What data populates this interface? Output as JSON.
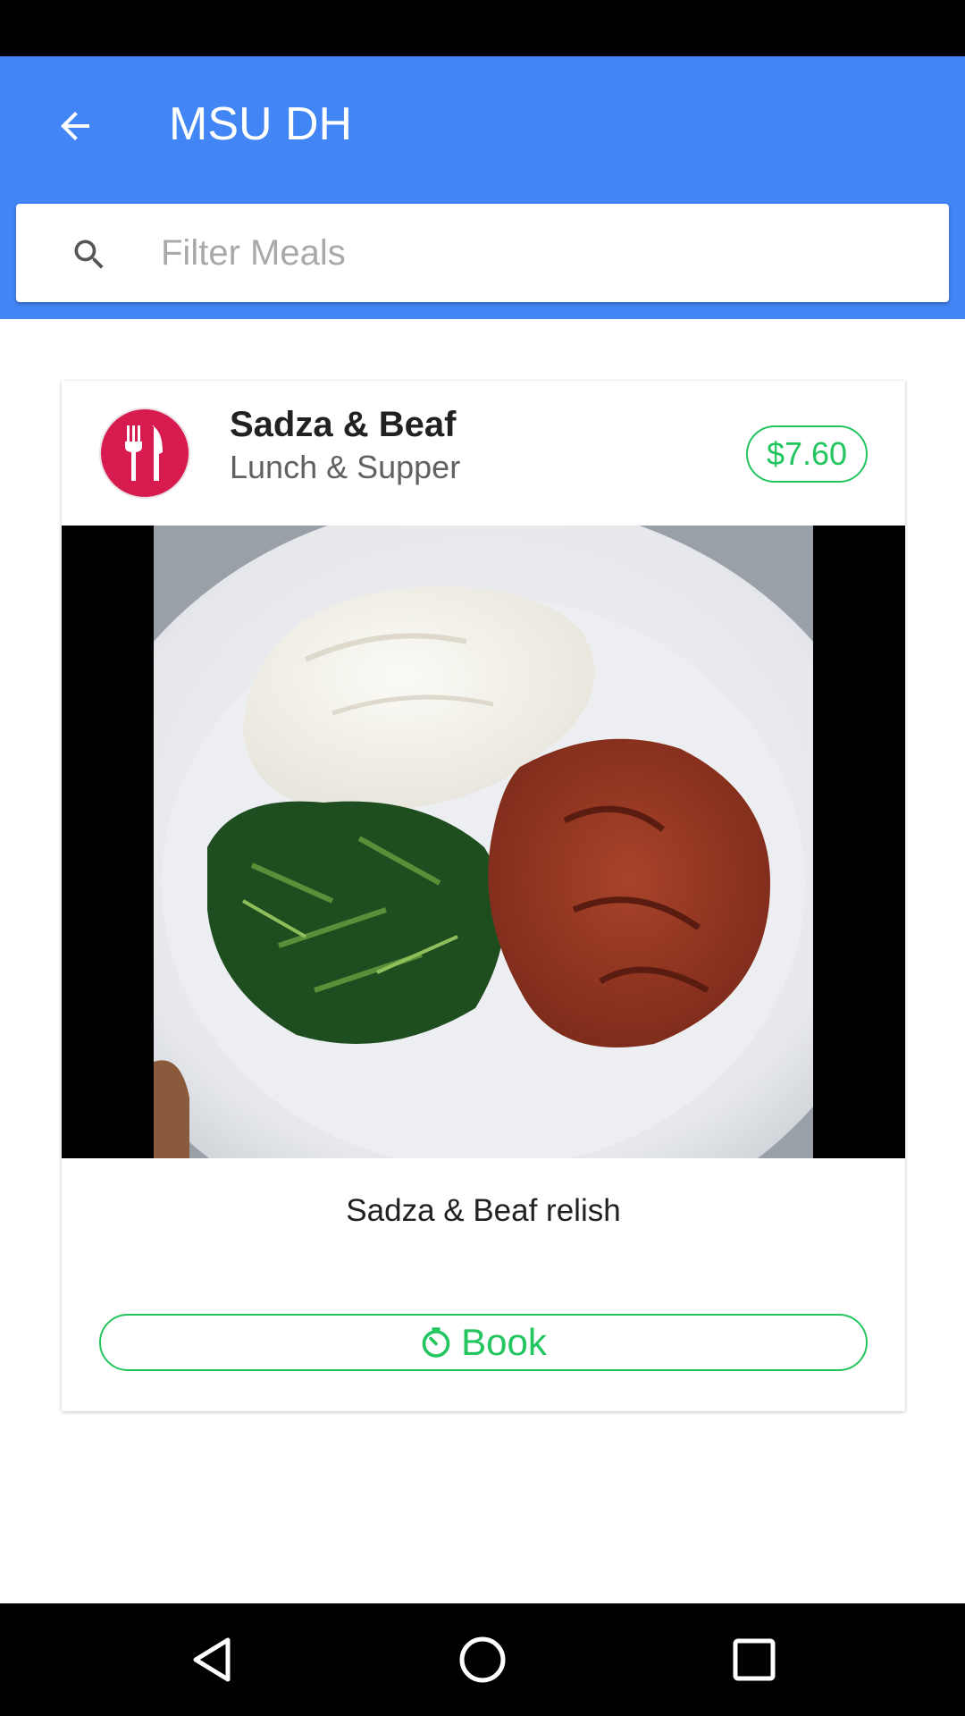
{
  "app_bar": {
    "title": "MSU DH",
    "color": "#4285f4",
    "back_icon": "arrow-back-icon"
  },
  "search": {
    "placeholder": "Filter Meals",
    "icon": "search-icon"
  },
  "meal_card": {
    "title": "Sadza & Beaf",
    "subtitle": "Lunch & Supper",
    "price": "$7.60",
    "avatar_icon": "fork-knife-icon",
    "avatar_color": "#d81b4f",
    "description": "Sadza & Beaf relish",
    "book_label": "Book",
    "book_icon": "timer-icon",
    "accent_color": "#22c55e"
  },
  "nav_bar": {
    "back_icon": "nav-back-icon",
    "home_icon": "nav-home-icon",
    "recents_icon": "nav-recents-icon"
  }
}
